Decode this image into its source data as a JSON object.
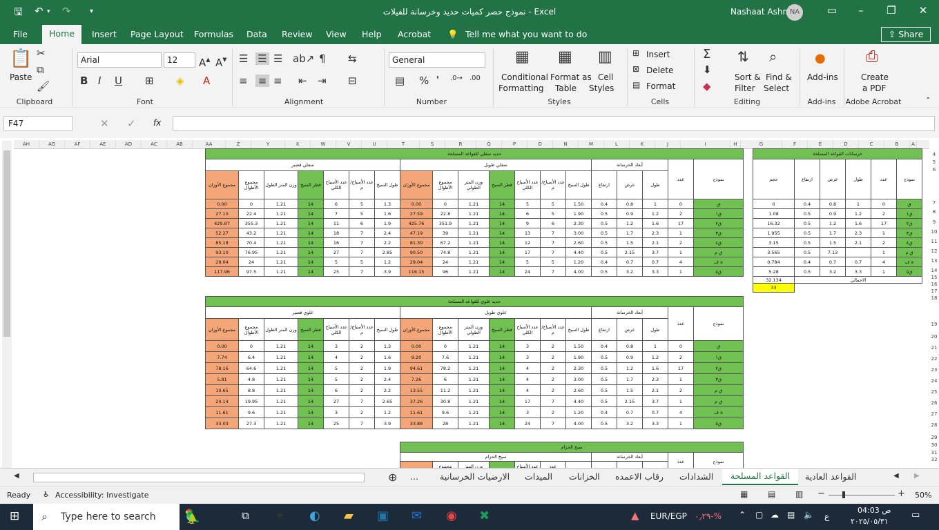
{
  "window": {
    "title": "نموذج حصر كميات حديد وخرسانة للفيلات  -  Excel",
    "user": "Nashaat Ashm",
    "initials": "NA"
  },
  "tabs": [
    "File",
    "Home",
    "Insert",
    "Page Layout",
    "Formulas",
    "Data",
    "Review",
    "View",
    "Help",
    "Acrobat"
  ],
  "tellme": "Tell me what you want to do",
  "share": "Share",
  "ribbon": {
    "paste": "Paste",
    "clipboard": "Clipboard",
    "font_name": "Arial",
    "font_size": "12",
    "font": "Font",
    "alignment": "Alignment",
    "number_format": "General",
    "number": "Number",
    "cond_fmt": [
      "Conditional",
      "Formatting"
    ],
    "fmt_table": [
      "Format as",
      "Table"
    ],
    "cell_styles": [
      "Cell",
      "Styles"
    ],
    "styles": "Styles",
    "insert": "Insert",
    "delete": "Delete",
    "format": "Format",
    "cells": "Cells",
    "sort": [
      "Sort &",
      "Filter"
    ],
    "find": [
      "Find &",
      "Select"
    ],
    "editing": "Editing",
    "addins": "Add-ins",
    "addins_group": "Add-ins",
    "create_pdf": [
      "Create",
      "a PDF"
    ],
    "acrobat": "Adobe Acrobat"
  },
  "namebox": "F47",
  "fx": "fx",
  "columns": [
    "AH",
    "AG",
    "AF",
    "AE",
    "AD",
    "AC",
    "AB",
    "AA",
    "Z",
    "Y",
    "X",
    "W",
    "V",
    "U",
    "T",
    "S",
    "R",
    "Q",
    "P",
    "O",
    "N",
    "M",
    "L",
    "K",
    "J",
    "I",
    "H",
    "G",
    "F",
    "E",
    "D",
    "C",
    "B",
    "A"
  ],
  "rows": [
    "4",
    "5",
    "6",
    "7",
    "8",
    "9",
    "10",
    "11",
    "12",
    "13",
    "14",
    "15",
    "16",
    "17",
    "18",
    "19",
    "20",
    "21",
    "22",
    "23",
    "24",
    "25",
    "26",
    "27",
    "28",
    "29",
    "30",
    "31",
    "32"
  ],
  "table1": {
    "title": "حديد سفلي للقواعد المسلحة",
    "short": "سفلي قصير",
    "long": "سفلي طويل",
    "dims": "أبعاد الخرسانة",
    "count": "عدد",
    "model": "نموذج",
    "headers": [
      "مجموع الأوزان",
      "مجموع الأطوال",
      "وزن المتر الطول",
      "قطر السيخ",
      "عدد الأسياخ الكلي",
      "عدد الأسياخ/م",
      "طول السيخ",
      "مجموع الأوزان",
      "مجموع الأطوال",
      "وزن المتر الطولي",
      "قطر السيخ",
      "عدد الأسياخ الكلي",
      "عدد الأسياخ/م",
      "طول السيخ",
      "ارتفاع",
      "عرض",
      "طول",
      "عدد",
      "نموذج"
    ],
    "rows": [
      [
        "0.00",
        "0",
        "1.21",
        "14",
        "6",
        "5",
        "1.3",
        "0.00",
        "0",
        "1.21",
        "14",
        "5",
        "5",
        "1.50",
        "0.4",
        "0.8",
        "1",
        "0",
        "ق"
      ],
      [
        "27.10",
        "22.4",
        "1.21",
        "14",
        "7",
        "5",
        "1.6",
        "27.59",
        "22.8",
        "1.21",
        "14",
        "6",
        "5",
        "1.90",
        "0.5",
        "0.9",
        "1.2",
        "2",
        "ق١"
      ],
      [
        "429.87",
        "355.3",
        "1.21",
        "14",
        "11",
        "6",
        "1.9",
        "425.76",
        "351.9",
        "1.21",
        "14",
        "9",
        "6",
        "2.30",
        "0.5",
        "1.2",
        "1.6",
        "17",
        "ق٢"
      ],
      [
        "52.27",
        "43.2",
        "1.21",
        "14",
        "18",
        "7",
        "2.4",
        "47.19",
        "39",
        "1.21",
        "14",
        "13",
        "7",
        "3.00",
        "0.5",
        "1.7",
        "2.3",
        "1",
        "ق٣"
      ],
      [
        "85.18",
        "70.4",
        "1.21",
        "14",
        "16",
        "7",
        "2.2",
        "81.30",
        "67.2",
        "1.21",
        "14",
        "12",
        "7",
        "2.60",
        "0.5",
        "1.5",
        "2.1",
        "2",
        "ق٤"
      ],
      [
        "93.10",
        "76.95",
        "1.21",
        "14",
        "27",
        "7",
        "2.85",
        "90.50",
        "74.8",
        "1.21",
        "14",
        "17",
        "7",
        "4.40",
        "0.5",
        "2.15",
        "3.7",
        "1",
        "ق م"
      ],
      [
        "29.04",
        "24",
        "1.21",
        "14",
        "5",
        "5",
        "1.2",
        "29.04",
        "24",
        "1.21",
        "14",
        "5",
        "5",
        "1.20",
        "0.4",
        "0.7",
        "0.7",
        "4",
        "ف x"
      ],
      [
        "117.96",
        "97.5",
        "1.21",
        "14",
        "25",
        "7",
        "3.9",
        "116.15",
        "96",
        "1.21",
        "14",
        "24",
        "7",
        "4.00",
        "0.5",
        "3.2",
        "3.3",
        "1",
        "ق٥"
      ]
    ]
  },
  "table2": {
    "title": "حديد علوي للقواعد المسلحة",
    "short": "علوي قصير",
    "long": "علوي طويل",
    "dims": "أبعاد الخرسانة",
    "count": "عدد",
    "model": "نموذج",
    "rows": [
      [
        "0.00",
        "0",
        "1.21",
        "14",
        "3",
        "2",
        "1.3",
        "0.00",
        "0",
        "1.21",
        "14",
        "3",
        "2",
        "1.50",
        "0.4",
        "0.8",
        "1",
        "0",
        "ق"
      ],
      [
        "7.74",
        "6.4",
        "1.21",
        "14",
        "4",
        "2",
        "1.6",
        "9.20",
        "7.6",
        "1.21",
        "14",
        "3",
        "2",
        "1.90",
        "0.5",
        "0.9",
        "1.2",
        "2",
        "ق١"
      ],
      [
        "78.16",
        "64.6",
        "1.21",
        "14",
        "5",
        "2",
        "1.9",
        "94.61",
        "78.2",
        "1.21",
        "14",
        "4",
        "2",
        "2.30",
        "0.5",
        "1.2",
        "1.6",
        "17",
        "ق٢"
      ],
      [
        "5.81",
        "4.8",
        "1.21",
        "14",
        "5",
        "2",
        "2.4",
        "7.26",
        "6",
        "1.21",
        "14",
        "4",
        "2",
        "3.00",
        "0.5",
        "1.7",
        "2.3",
        "1",
        "ق٣"
      ],
      [
        "10.65",
        "8.8",
        "1.21",
        "14",
        "6",
        "2",
        "2.2",
        "13.55",
        "11.2",
        "1.21",
        "14",
        "4",
        "2",
        "2.60",
        "0.5",
        "1.5",
        "2.1",
        "2",
        "ق م"
      ],
      [
        "24.14",
        "19.95",
        "1.21",
        "14",
        "27",
        "7",
        "2.65",
        "37.26",
        "30.8",
        "1.21",
        "14",
        "17",
        "7",
        "4.40",
        "0.5",
        "2.15",
        "3.7",
        "1",
        "ق م"
      ],
      [
        "11.61",
        "9.6",
        "1.21",
        "14",
        "3",
        "2",
        "1.2",
        "11.61",
        "9.6",
        "1.21",
        "14",
        "3",
        "2",
        "1.20",
        "0.4",
        "0.7",
        "0.7",
        "4",
        "ف x"
      ],
      [
        "33.03",
        "27.3",
        "1.21",
        "14",
        "25",
        "7",
        "3.9",
        "33.88",
        "28",
        "1.21",
        "14",
        "24",
        "7",
        "4.00",
        "0.5",
        "3.2",
        "3.3",
        "1",
        "ق٥"
      ]
    ]
  },
  "table3": {
    "title": "سيخ الحزام",
    "sub": "سيخ الحزام",
    "dims": "أبعاد الخرسانة",
    "count": "عدد",
    "model": "نموذج",
    "h1": "مجموع",
    "h2": "وزن المتر",
    "h3": "عدد الأسياخ",
    "h4": "عدد"
  },
  "concrete": {
    "title": "خرسانات القواعد المسلحة",
    "headers": [
      "حجم",
      "ارتفاع",
      "عرض",
      "طول",
      "عدد",
      "نموذج"
    ],
    "rows": [
      [
        "0",
        "0.4",
        "0.8",
        "1",
        "0",
        "ق"
      ],
      [
        "1.08",
        "0.5",
        "0.9",
        "1.2",
        "2",
        "ق١"
      ],
      [
        "16.32",
        "0.5",
        "1.2",
        "1.6",
        "17",
        "ق٢"
      ],
      [
        "1.955",
        "0.5",
        "1.7",
        "2.3",
        "1",
        "ق٣"
      ],
      [
        "3.15",
        "0.5",
        "1.5",
        "2.1",
        "2",
        "ق٤"
      ],
      [
        "3.565",
        "0.5",
        "7.13",
        "",
        "1",
        "ق م"
      ],
      [
        "0.784",
        "0.4",
        "0.7",
        "0.7",
        "4",
        "ف x"
      ],
      [
        "5.28",
        "0.5",
        "3.2",
        "3.3",
        "1",
        "ق٥"
      ]
    ],
    "total": "32.134",
    "total_label": "الاجمالي",
    "yellow": "33"
  },
  "sheet_tabs": [
    "...",
    "الارضيات الخرسانية",
    "الميدات",
    "الخزانات",
    "رقاب الاعمده",
    "الشدادات",
    "القواعد المسلحة",
    "القواعد العادية"
  ],
  "status": {
    "ready": "Ready",
    "access": "Accessibility: Investigate",
    "zoom": "50%"
  },
  "taskbar": {
    "search": "Type here to search",
    "currency": "EUR/EGP",
    "change": "٠٫٢٩-%",
    "time": "04:03 ص",
    "date": "٢٠٢٥/٠٥/٣١",
    "lang": "ع"
  }
}
